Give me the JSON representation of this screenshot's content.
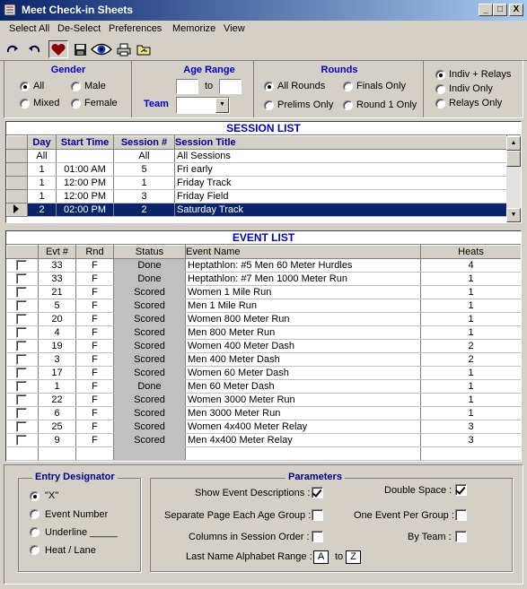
{
  "window": {
    "title": "Meet Check-in Sheets",
    "controls": [
      "_",
      "□",
      "X"
    ]
  },
  "menu": [
    "Select All",
    "De-Select",
    "Preferences",
    "Memorize",
    "View"
  ],
  "toolbar": {
    "icons": [
      "undo-redo-icon",
      "undo-icon",
      "heart-icon",
      "save-icon",
      "preview-eye-icon",
      "print-icon",
      "export-folder-icon"
    ]
  },
  "filters": {
    "gender": {
      "title": "Gender",
      "options": [
        "All",
        "Male",
        "Mixed",
        "Female"
      ],
      "selected": "All"
    },
    "age_range": {
      "title": "Age Range",
      "from": "",
      "to_label": "to",
      "to": ""
    },
    "team": {
      "label": "Team",
      "value": ""
    },
    "rounds": {
      "title": "Rounds",
      "options": [
        "All Rounds",
        "Finals Only",
        "Prelims Only",
        "Round 1 Only"
      ],
      "selected": "All Rounds"
    },
    "indiv_relay": {
      "options": [
        "Indiv + Relays",
        "Indiv Only",
        "Relays Only"
      ],
      "selected": "Indiv + Relays"
    }
  },
  "session_list": {
    "title": "SESSION LIST",
    "columns": [
      "Day",
      "Start Time",
      "Session #",
      "Session Title"
    ],
    "rows": [
      {
        "day": "All",
        "start": "",
        "num": "All",
        "title": "All Sessions"
      },
      {
        "day": "1",
        "start": "01:00 AM",
        "num": "5",
        "title": "Fri early"
      },
      {
        "day": "1",
        "start": "12:00 PM",
        "num": "1",
        "title": "Friday Track"
      },
      {
        "day": "1",
        "start": "12:00 PM",
        "num": "3",
        "title": "Friday Field"
      },
      {
        "day": "2",
        "start": "02:00 PM",
        "num": "2",
        "title": "Saturday Track"
      }
    ],
    "selected_index": 4
  },
  "event_list": {
    "title": "EVENT LIST",
    "columns": [
      "Evt #",
      "Rnd",
      "Status",
      "Event Name",
      "Heats"
    ],
    "rows": [
      {
        "evt": "33",
        "rnd": "F",
        "status": "Done",
        "name": "Heptathlon: #5 Men 60 Meter Hurdles",
        "heats": "4"
      },
      {
        "evt": "33",
        "rnd": "F",
        "status": "Done",
        "name": "Heptathlon: #7 Men 1000 Meter Run",
        "heats": "1"
      },
      {
        "evt": "21",
        "rnd": "F",
        "status": "Scored",
        "name": "Women 1 Mile Run",
        "heats": "1"
      },
      {
        "evt": "5",
        "rnd": "F",
        "status": "Scored",
        "name": "Men 1 Mile Run",
        "heats": "1"
      },
      {
        "evt": "20",
        "rnd": "F",
        "status": "Scored",
        "name": "Women 800 Meter Run",
        "heats": "1"
      },
      {
        "evt": "4",
        "rnd": "F",
        "status": "Scored",
        "name": "Men 800 Meter Run",
        "heats": "1"
      },
      {
        "evt": "19",
        "rnd": "F",
        "status": "Scored",
        "name": "Women 400 Meter Dash",
        "heats": "2"
      },
      {
        "evt": "3",
        "rnd": "F",
        "status": "Scored",
        "name": "Men 400 Meter Dash",
        "heats": "2"
      },
      {
        "evt": "17",
        "rnd": "F",
        "status": "Scored",
        "name": "Women 60 Meter Dash",
        "heats": "1"
      },
      {
        "evt": "1",
        "rnd": "F",
        "status": "Done",
        "name": "Men 60 Meter Dash",
        "heats": "1"
      },
      {
        "evt": "22",
        "rnd": "F",
        "status": "Scored",
        "name": "Women 3000 Meter Run",
        "heats": "1"
      },
      {
        "evt": "6",
        "rnd": "F",
        "status": "Scored",
        "name": "Men 3000 Meter Run",
        "heats": "1"
      },
      {
        "evt": "25",
        "rnd": "F",
        "status": "Scored",
        "name": "Women 4x400 Meter Relay",
        "heats": "3"
      },
      {
        "evt": "9",
        "rnd": "F",
        "status": "Scored",
        "name": "Men 4x400 Meter Relay",
        "heats": "3"
      }
    ]
  },
  "entry_designator": {
    "title": "Entry Designator",
    "options": [
      "\"X\"",
      "Event Number",
      "Underline _____",
      "Heat / Lane"
    ],
    "selected": "\"X\""
  },
  "parameters": {
    "title": "Parameters",
    "show_event_descriptions": {
      "label": "Show Event Descriptions :",
      "checked": true
    },
    "double_space": {
      "label": "Double Space :",
      "checked": true
    },
    "separate_page": {
      "label": "Separate Page Each Age Group :",
      "checked": false
    },
    "one_event_per_group": {
      "label": "One Event Per Group :",
      "checked": false
    },
    "columns_session_order": {
      "label": "Columns in Session Order :",
      "checked": false
    },
    "by_team": {
      "label": "By Team :",
      "checked": false
    },
    "alpha_range": {
      "label": "Last Name Alphabet Range :",
      "from": "A",
      "to_label": "to",
      "to": "Z"
    }
  },
  "colors": {
    "title_bar": "#0a246a",
    "header_blue": "#0000c0",
    "selection": "#0a246a",
    "face": "#d4d0c8"
  }
}
